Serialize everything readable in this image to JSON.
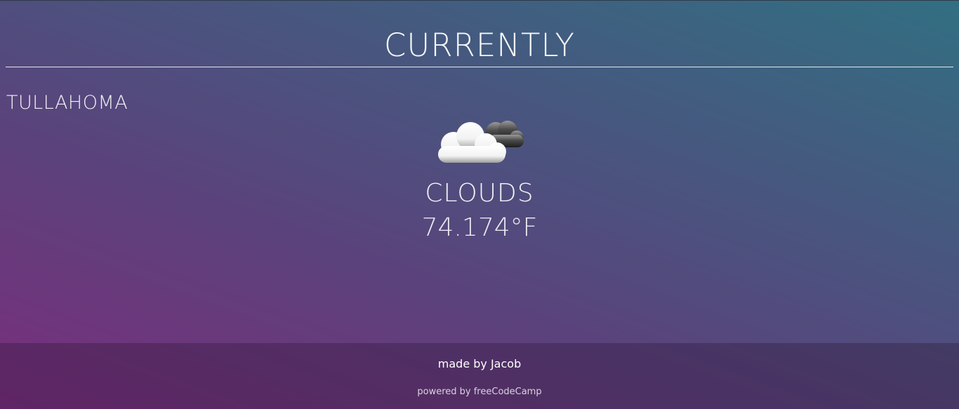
{
  "header": {
    "title": "CURRENTLY"
  },
  "location": {
    "city": "TULLAHOMA"
  },
  "weather": {
    "icon": "cloud-icon",
    "condition": "CLOUDS",
    "temperature": "74.174°F"
  },
  "footer": {
    "made_by": "made by Jacob",
    "powered_by": "powered by freeCodeCamp"
  },
  "colors": {
    "gradient_top_right": "#326f82",
    "gradient_bottom_left": "#7a2e7c",
    "text": "#ffffff"
  }
}
